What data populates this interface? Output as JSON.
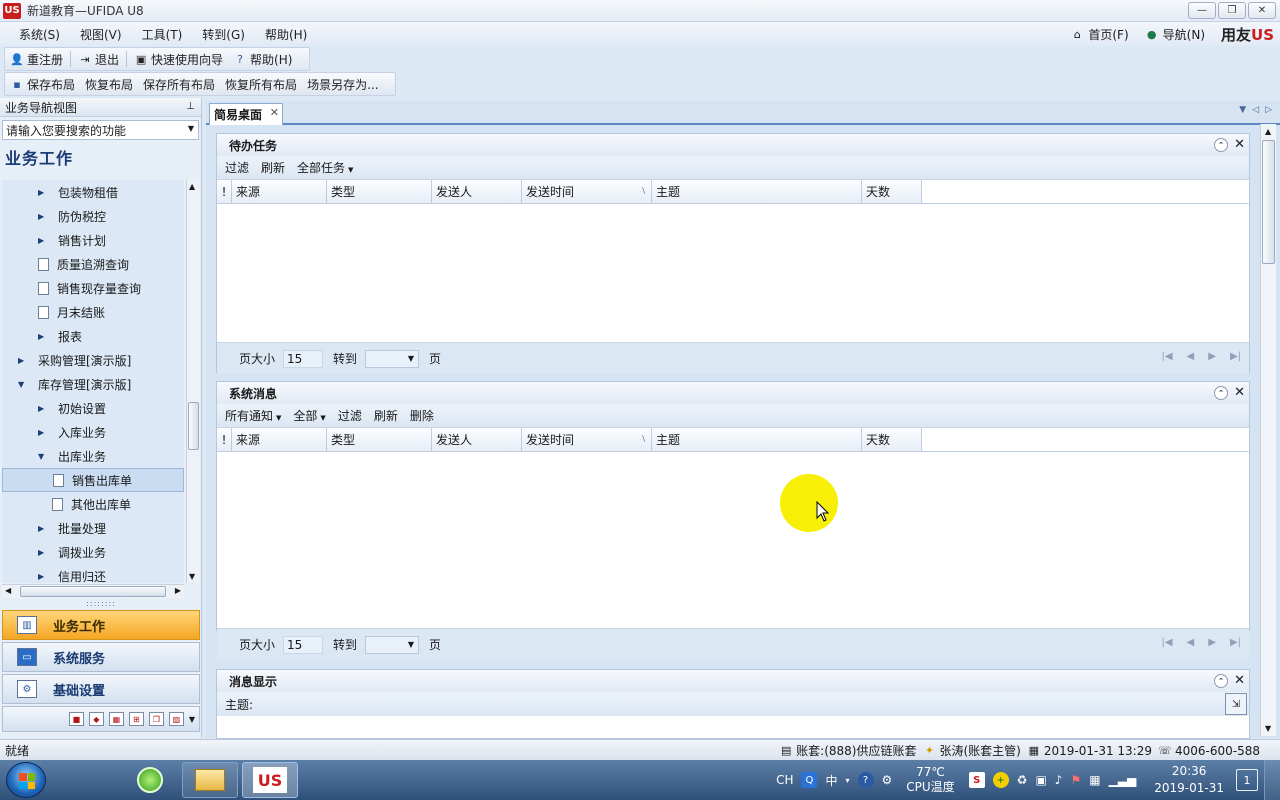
{
  "window": {
    "title": "新道教育—UFIDA U8",
    "logo_text": "US",
    "buttons": [
      "—",
      "❐",
      "✕"
    ]
  },
  "menubar": {
    "items": [
      "系统(S)",
      "视图(V)",
      "工具(T)",
      "转到(G)",
      "帮助(H)"
    ],
    "home": "首页(F)",
    "nav": "导航(N)",
    "brand": "用友",
    "brand_mark": "US"
  },
  "toolbar1": {
    "relogin": "重注册",
    "exit": "退出",
    "wizard": "快速使用向导",
    "help": "帮助(H)"
  },
  "toolbar2": {
    "save_layout": "保存布局",
    "restore_layout": "恢复布局",
    "save_all": "保存所有布局",
    "restore_all": "恢复所有布局",
    "save_as": "场景另存为..."
  },
  "leftpanel": {
    "header": "业务导航视图",
    "search_placeholder": "请输入您要搜索的功能",
    "section_title": "业务工作",
    "tree": [
      {
        "label": "包装物租借",
        "kind": "folder",
        "indent": 2
      },
      {
        "label": "防伪税控",
        "kind": "folder",
        "indent": 2
      },
      {
        "label": "销售计划",
        "kind": "folder",
        "indent": 2
      },
      {
        "label": "质量追溯查询",
        "kind": "doc",
        "indent": 2
      },
      {
        "label": "销售现存量查询",
        "kind": "doc",
        "indent": 2
      },
      {
        "label": "月末结账",
        "kind": "doc",
        "indent": 2
      },
      {
        "label": "报表",
        "kind": "folder",
        "indent": 2
      },
      {
        "label": "采购管理[演示版]",
        "kind": "folder",
        "indent": 1
      },
      {
        "label": "库存管理[演示版]",
        "kind": "open",
        "indent": 1
      },
      {
        "label": "初始设置",
        "kind": "folder",
        "indent": 2
      },
      {
        "label": "入库业务",
        "kind": "folder",
        "indent": 2
      },
      {
        "label": "出库业务",
        "kind": "open",
        "indent": 2
      },
      {
        "label": "销售出库单",
        "kind": "doc",
        "indent": 3,
        "selected": true
      },
      {
        "label": "其他出库单",
        "kind": "doc",
        "indent": 3
      },
      {
        "label": "批量处理",
        "kind": "folder",
        "indent": 2
      },
      {
        "label": "调拨业务",
        "kind": "folder",
        "indent": 2
      },
      {
        "label": "信用归还",
        "kind": "folder",
        "indent": 2
      }
    ],
    "nav_buttons": [
      "业务工作",
      "系统服务",
      "基础设置"
    ],
    "grip": "::::::::"
  },
  "content": {
    "tab": "简易桌面",
    "todo": {
      "title": "待办任务",
      "tools": [
        "过滤",
        "刷新",
        "全部任务"
      ],
      "columns": [
        "!",
        "来源",
        "类型",
        "发送人",
        "发送时间",
        "主题",
        "天数"
      ],
      "page_size_label": "页大小",
      "page_size": "15",
      "goto_label": "转到",
      "page_label": "页"
    },
    "messages": {
      "title": "系统消息",
      "tools": [
        "所有通知",
        "全部",
        "过滤",
        "刷新",
        "删除"
      ],
      "columns": [
        "!",
        "来源",
        "类型",
        "发送人",
        "发送时间",
        "主题",
        "天数"
      ],
      "page_size_label": "页大小",
      "page_size": "15",
      "goto_label": "转到",
      "page_label": "页"
    },
    "display": {
      "title": "消息显示",
      "subject_label": "主题:"
    }
  },
  "statusbar": {
    "ready": "就绪",
    "account": "账套:(888)供应链账套",
    "user": "张涛(账套主管)",
    "datetime": "2019-01-31 13:29",
    "phone": "4006-600-588"
  },
  "taskbar": {
    "ime": "CH",
    "ime_mode": "中",
    "temperature": "77℃",
    "cpu_label": "CPU温度",
    "time": "20:36",
    "date": "2019-01-31",
    "notify_count": "1"
  }
}
